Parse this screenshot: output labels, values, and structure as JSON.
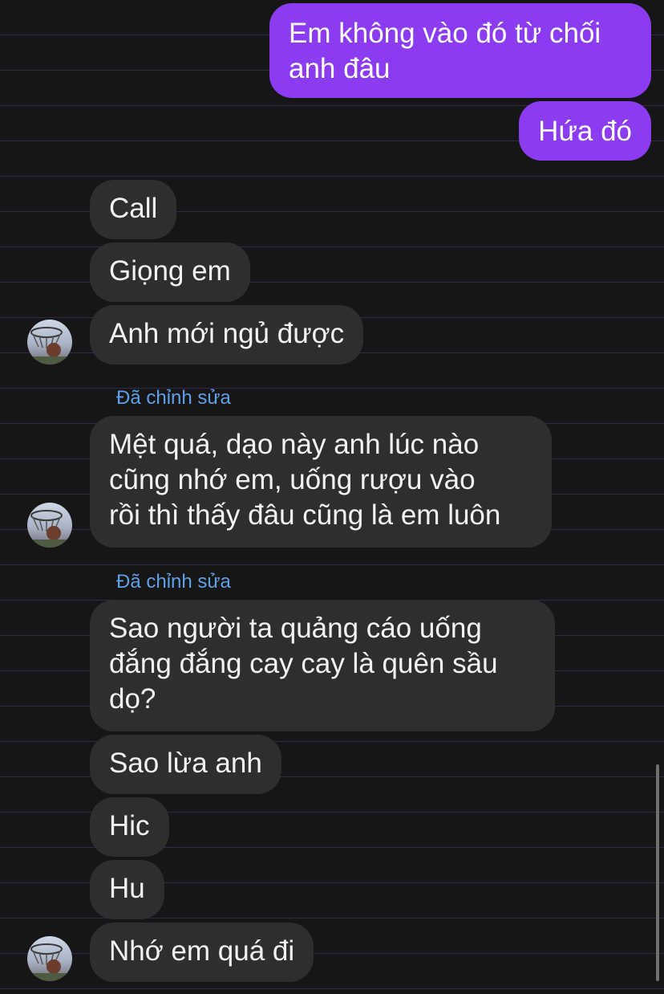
{
  "messages": [
    {
      "id": "m1",
      "direction": "outgoing",
      "text": "Em không vào đó từ chối\nanh đâu"
    },
    {
      "id": "m2",
      "direction": "outgoing",
      "text": "Hứa đó"
    },
    {
      "id": "m3",
      "direction": "incoming",
      "text": "Call"
    },
    {
      "id": "m4",
      "direction": "incoming",
      "text": "Giọng em"
    },
    {
      "id": "m5",
      "direction": "incoming",
      "text": "Anh mới ngủ được",
      "avatar": true
    },
    {
      "id": "m6",
      "direction": "incoming",
      "text": "Mệt quá, dạo này anh lúc nào\ncũng nhớ em, uống rượu vào\nrồi thì thấy đâu cũng là em luôn",
      "edited_label": "Đã chỉnh sửa",
      "avatar": true
    },
    {
      "id": "m7",
      "direction": "incoming",
      "text": "Sao người ta quảng cáo uống\nđắng đắng cay cay là quên sầu\ndọ?",
      "edited_label": "Đã chỉnh sửa"
    },
    {
      "id": "m8",
      "direction": "incoming",
      "text": "Sao lừa anh"
    },
    {
      "id": "m9",
      "direction": "incoming",
      "text": "Hic"
    },
    {
      "id": "m10",
      "direction": "incoming",
      "text": "Hu"
    },
    {
      "id": "m11",
      "direction": "incoming",
      "text": "Nhớ em quá đi",
      "avatar": true
    }
  ],
  "colors": {
    "background": "#161616",
    "outgoing_bubble": "#8b3bf0",
    "incoming_bubble": "#2e2e2e",
    "edited_label": "#5fa0e8"
  },
  "icons": {
    "avatar": "basketball-hoop-photo"
  }
}
